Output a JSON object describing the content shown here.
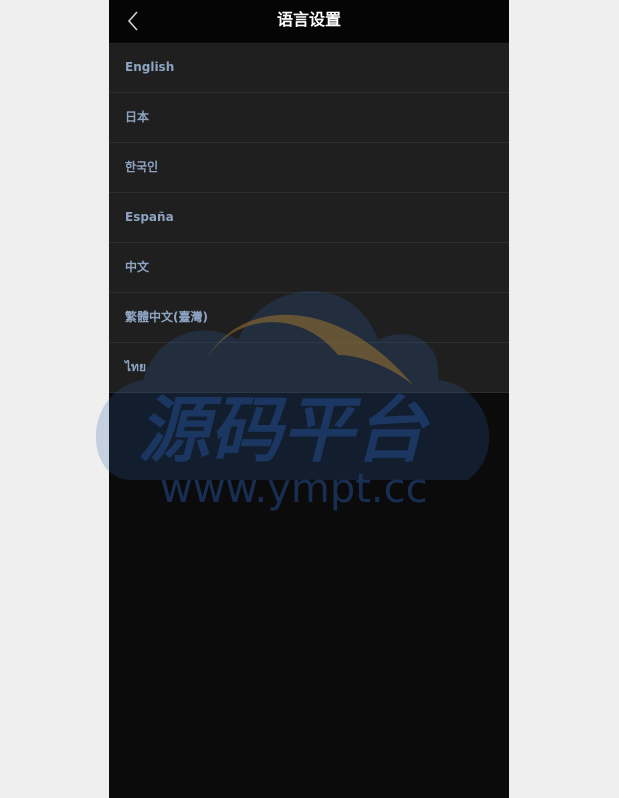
{
  "header": {
    "title": "语言设置",
    "back_icon": "chevron-left-icon"
  },
  "languages": [
    {
      "label": "English"
    },
    {
      "label": "日本"
    },
    {
      "label": "한국인"
    },
    {
      "label": "España"
    },
    {
      "label": "中文"
    },
    {
      "label": "繁體中文(臺灣)"
    },
    {
      "label": "ไทย"
    }
  ],
  "watermark": {
    "name": "源码平台",
    "url": "www.ympt.cc"
  },
  "colors": {
    "page_background": "#efefef",
    "app_background": "#0b0b0b",
    "header_background": "#050505",
    "list_item_background": "#1f1f1f",
    "list_item_text": "#8ea4c2",
    "title_text": "#ffffff"
  }
}
